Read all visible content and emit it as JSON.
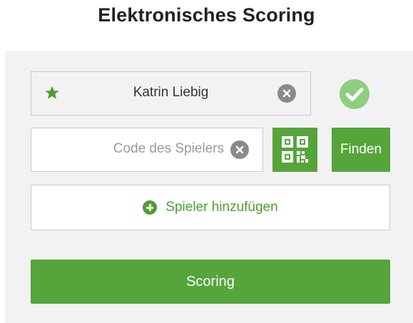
{
  "page": {
    "title": "Elektronisches Scoring"
  },
  "player": {
    "name": "Katrin Liebig",
    "icon": "star-icon",
    "clear_icon": "clear-icon",
    "status_icon": "check-circle-icon"
  },
  "search": {
    "placeholder": "Code des Spielers",
    "value": "",
    "qr_icon": "qr-code-icon",
    "find_label": "Finden"
  },
  "add_player": {
    "label": "Spieler hinzufügen",
    "icon": "plus-circle-icon"
  },
  "actions": {
    "scoring_label": "Scoring"
  },
  "colors": {
    "accent": "#55a53a",
    "accent_text": "#4c9e32",
    "check_light": "#8ccf7e",
    "icon_gray": "#8a8a8a",
    "panel_bg": "#f2f2f2",
    "border": "#c8c8c8"
  }
}
